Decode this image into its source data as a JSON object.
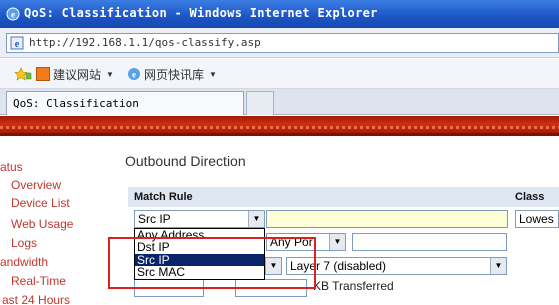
{
  "window": {
    "title": "QoS: Classification - Windows Internet Explorer",
    "address": "http://192.168.1.1/qos-classify.asp"
  },
  "favorites": [
    {
      "label": "建议网站",
      "icon": "suggested-sites-icon",
      "has_dropdown": true
    },
    {
      "label": "网页快讯库",
      "icon": "web-slice-icon",
      "has_dropdown": true
    }
  ],
  "tab": {
    "title": "QoS: Classification"
  },
  "nav": {
    "items": [
      "atus",
      "Overview",
      "Device List",
      "Web Usage",
      "Logs",
      "andwidth",
      "Real-Time",
      "ast 24 Hours"
    ]
  },
  "main": {
    "heading": "Outbound Direction",
    "col_match_rule": "Match Rule",
    "col_class": "Class",
    "match_select_value": "Src IP",
    "port_select_value": "Any Por",
    "layer7_value": "Layer 7 (disabled)",
    "class_value": "Lowes",
    "kb_text": "KB Transferred"
  },
  "dropdown": {
    "options": [
      "Any Address",
      "Dst IP",
      "Src IP",
      "Src MAC"
    ],
    "selected_index": 2
  },
  "colors": {
    "titlebar": "#1c55c6",
    "banner": "#c22a0e",
    "nav_link": "#c0372f",
    "highlight": "#d8231f",
    "selected_option": "#0a246a"
  }
}
